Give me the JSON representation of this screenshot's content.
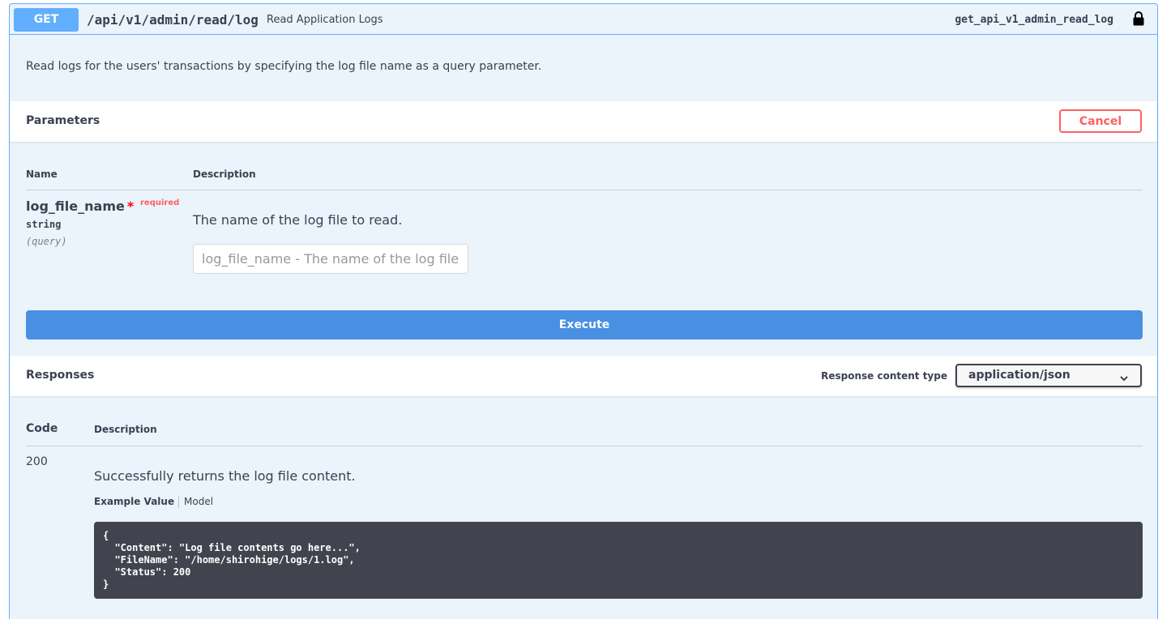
{
  "operation": {
    "method": "GET",
    "path": "/api/v1/admin/read/log",
    "summary": "Read Application Logs",
    "operation_id": "get_api_v1_admin_read_log",
    "description": "Read logs for the users' transactions by specifying the log file name as a query parameter.",
    "lock_icon": "lock-icon"
  },
  "parameters": {
    "title": "Parameters",
    "cancel_label": "Cancel",
    "col_name": "Name",
    "col_description": "Description",
    "items": [
      {
        "name": "log_file_name",
        "star": "*",
        "required_label": "required",
        "type": "string",
        "in": "(query)",
        "description": "The name of the log file to read.",
        "value": "",
        "placeholder": "log_file_name - The name of the log file"
      }
    ],
    "execute_label": "Execute"
  },
  "responses": {
    "title": "Responses",
    "content_type_label": "Response content type",
    "content_type_value": "application/json",
    "col_code": "Code",
    "col_description": "Description",
    "items": [
      {
        "code": "200",
        "description": "Successfully returns the log file content.",
        "tab_example": "Example Value",
        "tab_model": "Model",
        "example": "{\n  \"Content\": \"Log file contents go here...\",\n  \"FileName\": \"/home/shirohige/logs/1.log\",\n  \"Status\": 200\n}"
      }
    ]
  },
  "colors": {
    "get": "#61affe",
    "block_bg": "#ebf3fb",
    "execute": "#4990e2",
    "cancel": "#ff6060",
    "code_bg": "#41444e"
  }
}
